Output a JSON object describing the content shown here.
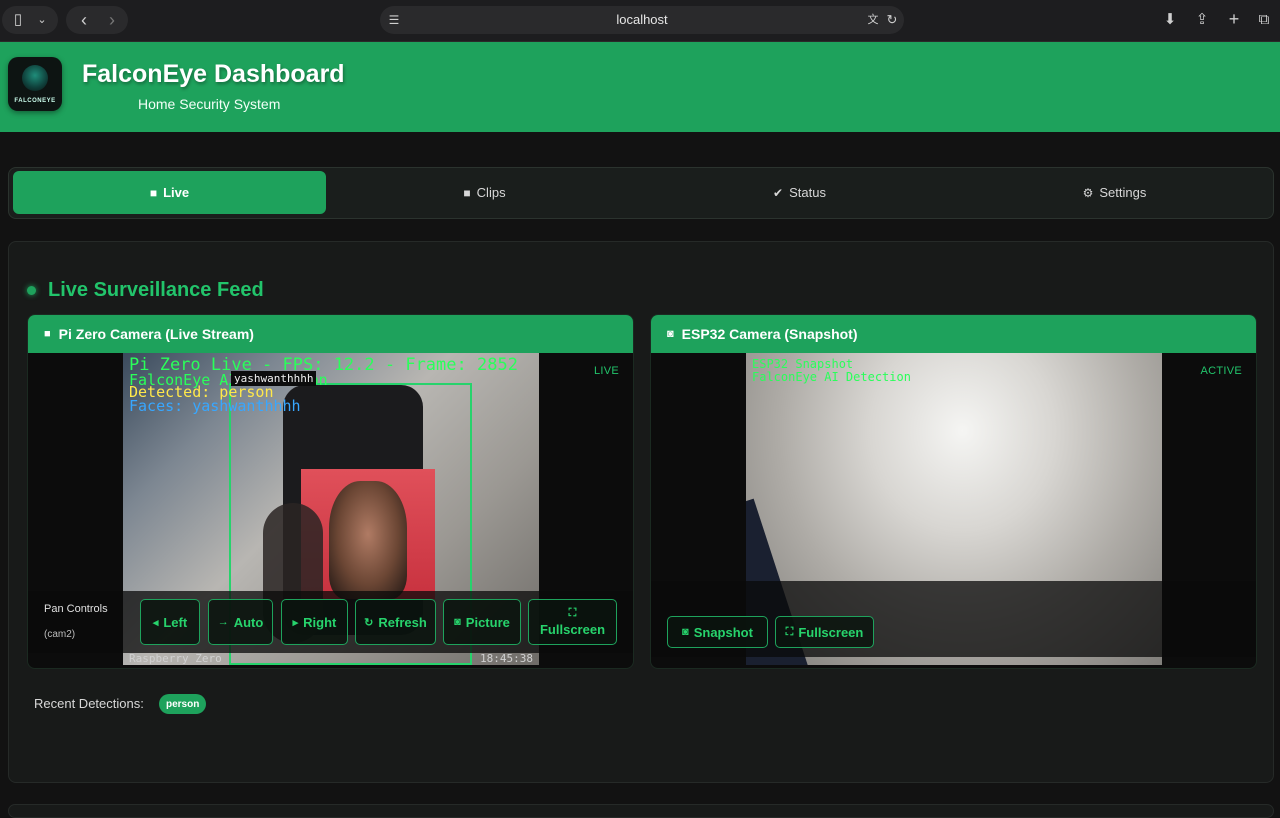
{
  "browser": {
    "url": "localhost",
    "icons": [
      "sidebar-icon",
      "chevron-down-icon",
      "back-icon",
      "forward-icon",
      "reader-icon",
      "translate-icon",
      "reload-icon",
      "download-icon",
      "share-icon",
      "new-tab-icon",
      "tabs-overview-icon"
    ]
  },
  "header": {
    "title": "FalconEye Dashboard",
    "subtitle": "Home Security System",
    "logo_text": "FALCONEYE"
  },
  "tabs": [
    {
      "label": "Live",
      "icon": "video-icon",
      "active": true
    },
    {
      "label": "Clips",
      "icon": "video-icon",
      "active": false
    },
    {
      "label": "Status",
      "icon": "check-circle-icon",
      "active": false
    },
    {
      "label": "Settings",
      "icon": "gear-icon",
      "active": false
    }
  ],
  "main": {
    "section_title": "Live Surveillance Feed",
    "cameras": [
      {
        "title": "Pi Zero Camera (Live Stream)",
        "icon": "video-icon",
        "badge": "LIVE",
        "overlay": {
          "line1": "Pi Zero Live - FPS: 12.2 - Frame: 2852",
          "line2": "FalconEye AI Detection",
          "line3": "Detected: person",
          "line4": "Faces: yashwanthhhh",
          "name_tag": "yashwanthhhh",
          "footer_left": "Raspberry Zero",
          "footer_right": "18:45:38"
        },
        "pan_label": "Pan Controls",
        "pan_sub": "(cam2)",
        "buttons": [
          {
            "label": "Left",
            "icon": "caret-left-icon"
          },
          {
            "label": "Auto",
            "icon": "arrow-right-icon"
          },
          {
            "label": "Right",
            "icon": "caret-right-icon"
          },
          {
            "label": "Refresh",
            "icon": "refresh-icon"
          },
          {
            "label": "Picture",
            "icon": "camera-icon"
          },
          {
            "label": "Fullscreen",
            "icon": "expand-icon"
          }
        ]
      },
      {
        "title": "ESP32 Camera (Snapshot)",
        "icon": "camera-icon",
        "badge": "ACTIVE",
        "overlay": {
          "line1": "ESP32 Snapshot",
          "line2": "FalconEye AI Detection"
        },
        "buttons": [
          {
            "label": "Snapshot",
            "icon": "camera-icon"
          },
          {
            "label": "Fullscreen",
            "icon": "expand-icon"
          }
        ]
      }
    ],
    "recent_label": "Recent Detections:",
    "recent_tags": [
      "person"
    ]
  },
  "colors": {
    "brand_green": "#1ea25c",
    "accent_green": "#22c46b",
    "background": "#121212"
  }
}
